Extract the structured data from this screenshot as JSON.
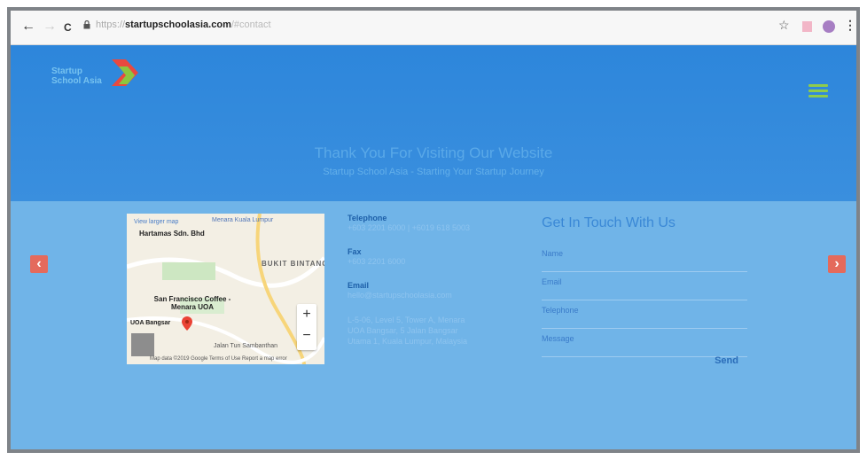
{
  "browser": {
    "back_icon": "←",
    "forward_icon": "→",
    "reload_icon": "C",
    "url_prefix": "https://",
    "url_host": "startupschoolasia.com",
    "url_path": "/#contact",
    "bookmark_icon": "☆",
    "menu_icon": "⋮",
    "extension_color": "#f2b6c7",
    "profile_color": "#a77ec3"
  },
  "header": {
    "logo_line1": "Startup",
    "logo_line2": "School Asia",
    "title": "Thank You For Visiting Our Website",
    "subtitle": "Startup School Asia - Starting Your Startup Journey"
  },
  "map": {
    "view_larger": "View larger map",
    "place_1": "Hartamas Sdn. Bhd",
    "place_2": "Menara Kuala Lumpur",
    "district": "BUKIT BINTANG",
    "cafe": "San Francisco Coffee - Menara UOA",
    "landmark": "UOA Bangsar",
    "street": "Jalan Tun Sambanthan",
    "attribution": "Map data ©2019 Google   Terms of Use   Report a map error",
    "zoom_in": "+",
    "zoom_out": "−"
  },
  "contact": {
    "telephone_label": "Telephone",
    "telephone_value": "+603 2201 6000 | +6019 618 5003",
    "fax_label": "Fax",
    "fax_value": "+603 2201 6000",
    "email_label": "Email",
    "email_value": "hello@startupschoolasia.com",
    "address": "L-5-06, Level 5, Tower A, Menara UOA Bangsar, 5 Jalan Bangsar Utama 1, Kuala Lumpur, Malaysia"
  },
  "form": {
    "title": "Get In Touch With Us",
    "name_label": "Name",
    "email_label": "Email",
    "telephone_label": "Telephone",
    "message_label": "Message",
    "send_label": "Send"
  },
  "arrows": {
    "left": "‹",
    "right": "›"
  }
}
